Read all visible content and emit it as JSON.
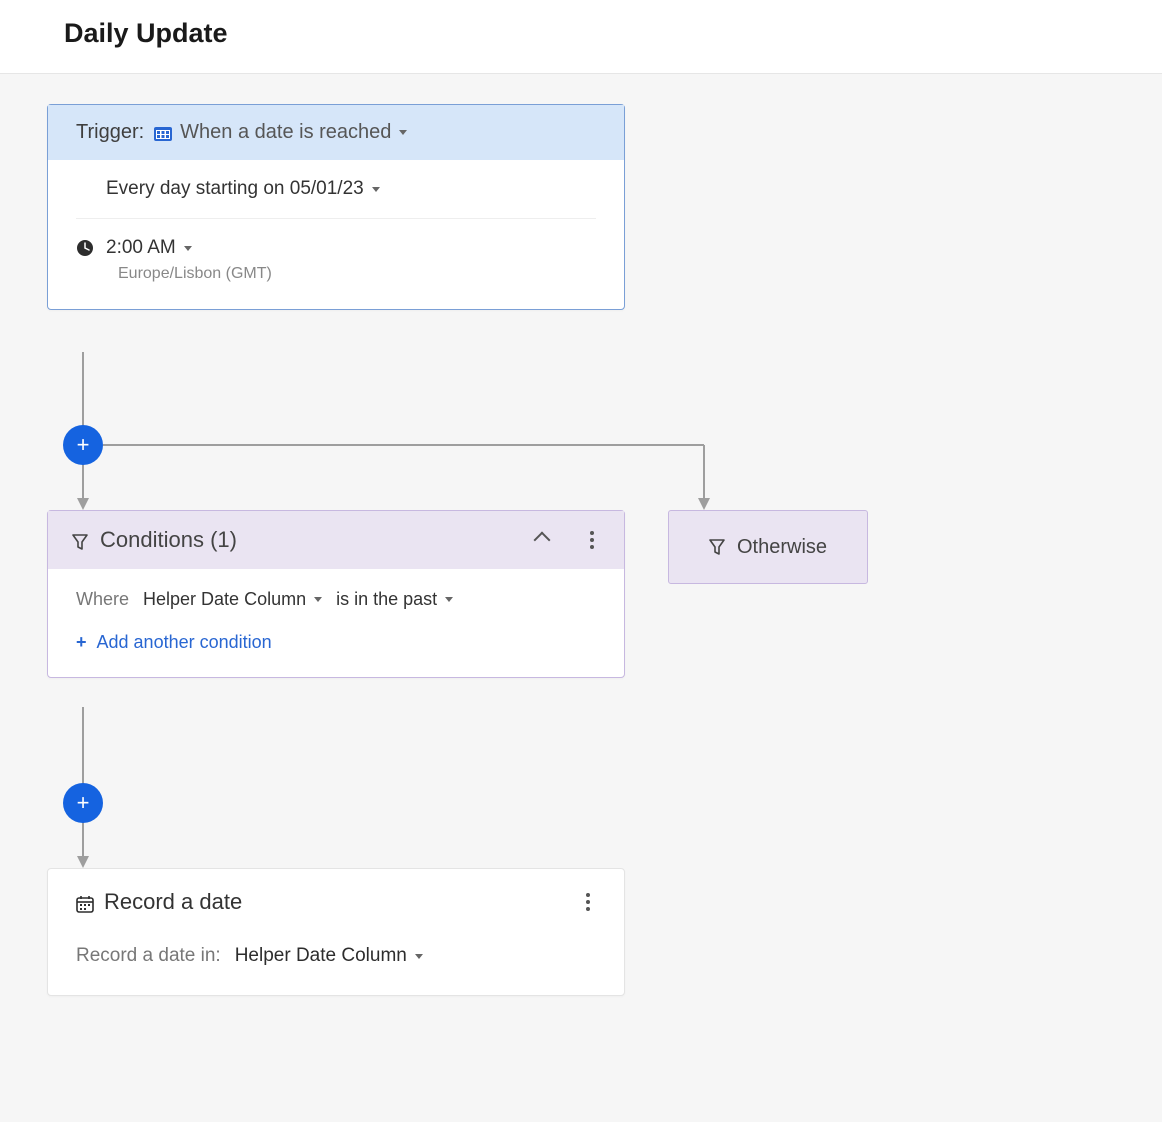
{
  "page": {
    "title": "Daily Update"
  },
  "trigger": {
    "label": "Trigger:",
    "event_label": "When a date is reached",
    "schedule": "Every day starting on 05/01/23",
    "time": "2:00 AM",
    "timezone": "Europe/Lisbon (GMT)"
  },
  "conditions": {
    "title": "Conditions (1)",
    "where_label": "Where",
    "column": "Helper Date Column",
    "operator": "is in the past",
    "add_label": "Add another condition"
  },
  "otherwise": {
    "label": "Otherwise"
  },
  "record": {
    "title": "Record a date",
    "label": "Record a date in:",
    "column": "Helper Date Column"
  }
}
